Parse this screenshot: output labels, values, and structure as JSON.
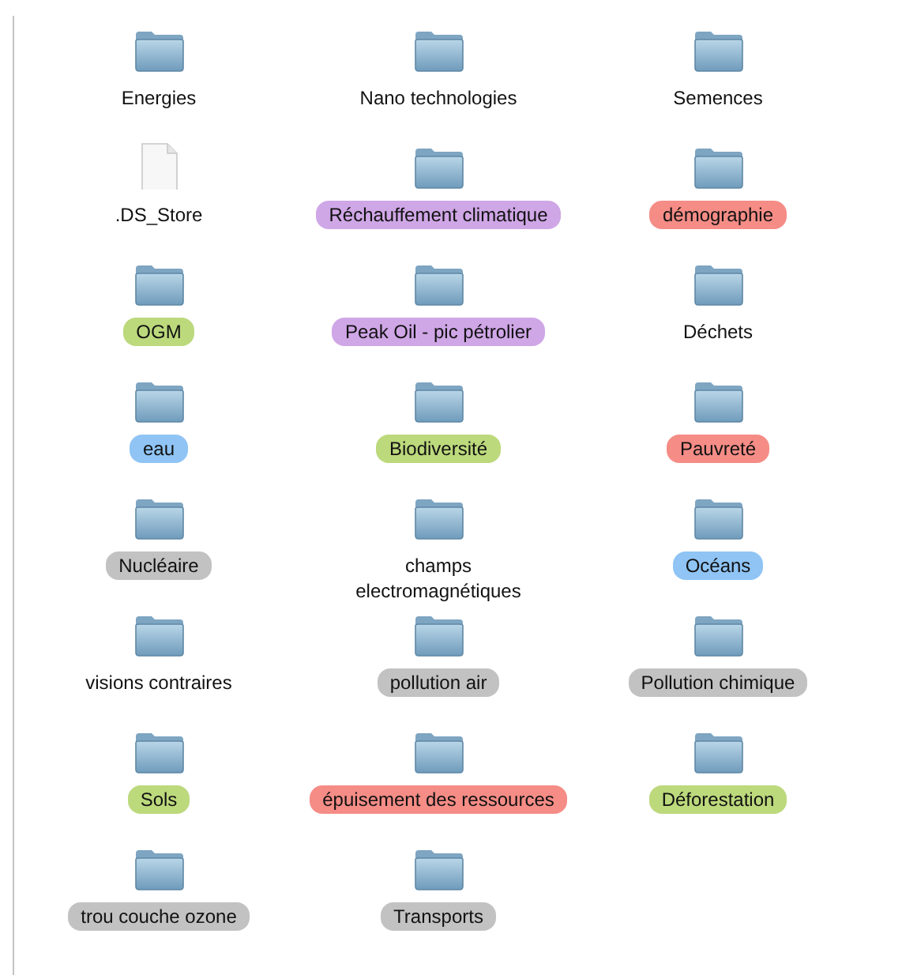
{
  "items": [
    {
      "name": "Energies",
      "kind": "folder"
    },
    {
      "name": "Nano technologies",
      "kind": "folder"
    },
    {
      "name": "Semences",
      "kind": "folder"
    },
    {
      "name": ".DS_Store",
      "kind": "file"
    },
    {
      "name": "Réchauffement climatique",
      "kind": "folder",
      "color": "#cfa6e6"
    },
    {
      "name": "démographie",
      "kind": "folder",
      "color": "#f58c86"
    },
    {
      "name": "OGM",
      "kind": "folder",
      "color": "#bcd97c"
    },
    {
      "name": "Peak Oil - pic pétrolier",
      "kind": "folder",
      "color": "#cfa6e6"
    },
    {
      "name": "Déchets",
      "kind": "folder"
    },
    {
      "name": "eau",
      "kind": "folder",
      "color": "#8fc4f5"
    },
    {
      "name": "Biodiversité",
      "kind": "folder",
      "color": "#bcd97c"
    },
    {
      "name": "Pauvreté",
      "kind": "folder",
      "color": "#f58c86"
    },
    {
      "name": "Nucléaire",
      "kind": "folder",
      "color": "#c2c2c2"
    },
    {
      "name": "champs electromagnétiques",
      "kind": "folder"
    },
    {
      "name": "Océans",
      "kind": "folder",
      "color": "#8fc4f5"
    },
    {
      "name": "visions contraires",
      "kind": "folder"
    },
    {
      "name": "pollution air",
      "kind": "folder",
      "color": "#c2c2c2"
    },
    {
      "name": "Pollution chimique",
      "kind": "folder",
      "color": "#c2c2c2"
    },
    {
      "name": "Sols",
      "kind": "folder",
      "color": "#bcd97c"
    },
    {
      "name": "épuisement des ressources",
      "kind": "folder",
      "color": "#f58c86"
    },
    {
      "name": "Déforestation",
      "kind": "folder",
      "color": "#bcd97c"
    },
    {
      "name": "trou couche ozone",
      "kind": "folder",
      "color": "#c2c2c2"
    },
    {
      "name": "Transports",
      "kind": "folder",
      "color": "#c2c2c2"
    }
  ]
}
